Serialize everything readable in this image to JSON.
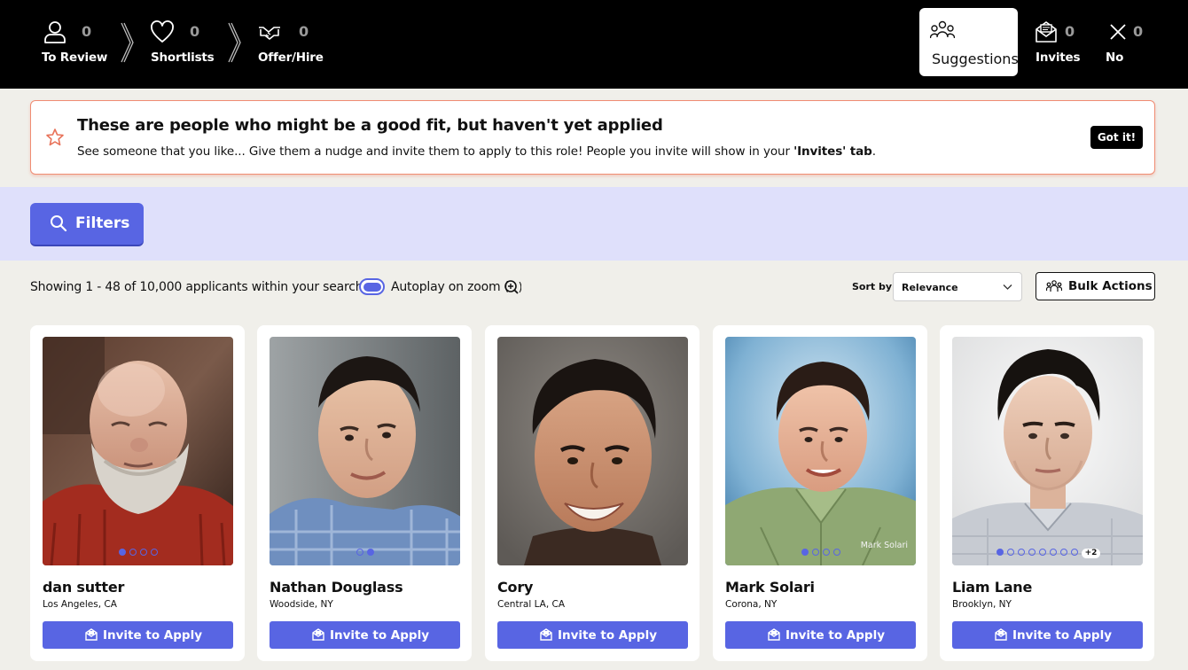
{
  "pipeline": {
    "to_review": {
      "label": "To Review",
      "count": "0",
      "icon": "person-icon"
    },
    "shortlists": {
      "label": "Shortlists",
      "count": "0",
      "icon": "heart-icon"
    },
    "offer_hire": {
      "label": "Offer/Hire",
      "count": "0",
      "icon": "handshake-icon"
    },
    "suggestions": {
      "label": "Suggestions",
      "icon": "people-group-icon"
    },
    "invites": {
      "label": "Invites",
      "count": "0",
      "icon": "envelope-icon"
    },
    "no": {
      "label": "No",
      "count": "0",
      "icon": "x-icon"
    }
  },
  "banner": {
    "title": "These are people who might be a good fit, but haven't yet applied",
    "body_start": "See someone that you like... Give them a nudge and invite them to apply to this role! People you invite will show in your ",
    "body_bold": "'Invites' tab",
    "body_end": ".",
    "dismiss_label": "Got it!"
  },
  "filters": {
    "label": "Filters"
  },
  "results": {
    "showing_text": "Showing 1 - 48 of 10,000 applicants within your search.",
    "autoplay_label": "Autoplay on zoom (",
    "autoplay_label_end": ")",
    "autoplay_on": true,
    "sort_label": "Sort by",
    "sort_value": "Relevance",
    "bulk_label": "Bulk Actions"
  },
  "colors": {
    "accent": "#5865e3",
    "banner_border": "#f08c73",
    "topbar": "#000000",
    "filter_strip": "#dfe0fb",
    "page_bg": "#f0efea"
  },
  "cards": [
    {
      "name": "dan sutter",
      "location": "Los Angeles, CA",
      "button": "Invite to Apply",
      "photos": 4,
      "active_photo": 1,
      "more": "",
      "watermark": ""
    },
    {
      "name": "Nathan Douglass",
      "location": "Woodside, NY",
      "button": "Invite to Apply",
      "photos": 2,
      "active_photo": 2,
      "more": "",
      "watermark": ""
    },
    {
      "name": "Cory",
      "location": "Central LA, CA",
      "button": "Invite to Apply",
      "photos": 0,
      "active_photo": 0,
      "more": "",
      "watermark": ""
    },
    {
      "name": "Mark Solari",
      "location": "Corona, NY",
      "button": "Invite to Apply",
      "photos": 4,
      "active_photo": 1,
      "more": "",
      "watermark": "Mark Solari"
    },
    {
      "name": "Liam Lane",
      "location": "Brooklyn, NY",
      "button": "Invite to Apply",
      "photos": 8,
      "active_photo": 1,
      "more": "+2",
      "watermark": ""
    }
  ]
}
